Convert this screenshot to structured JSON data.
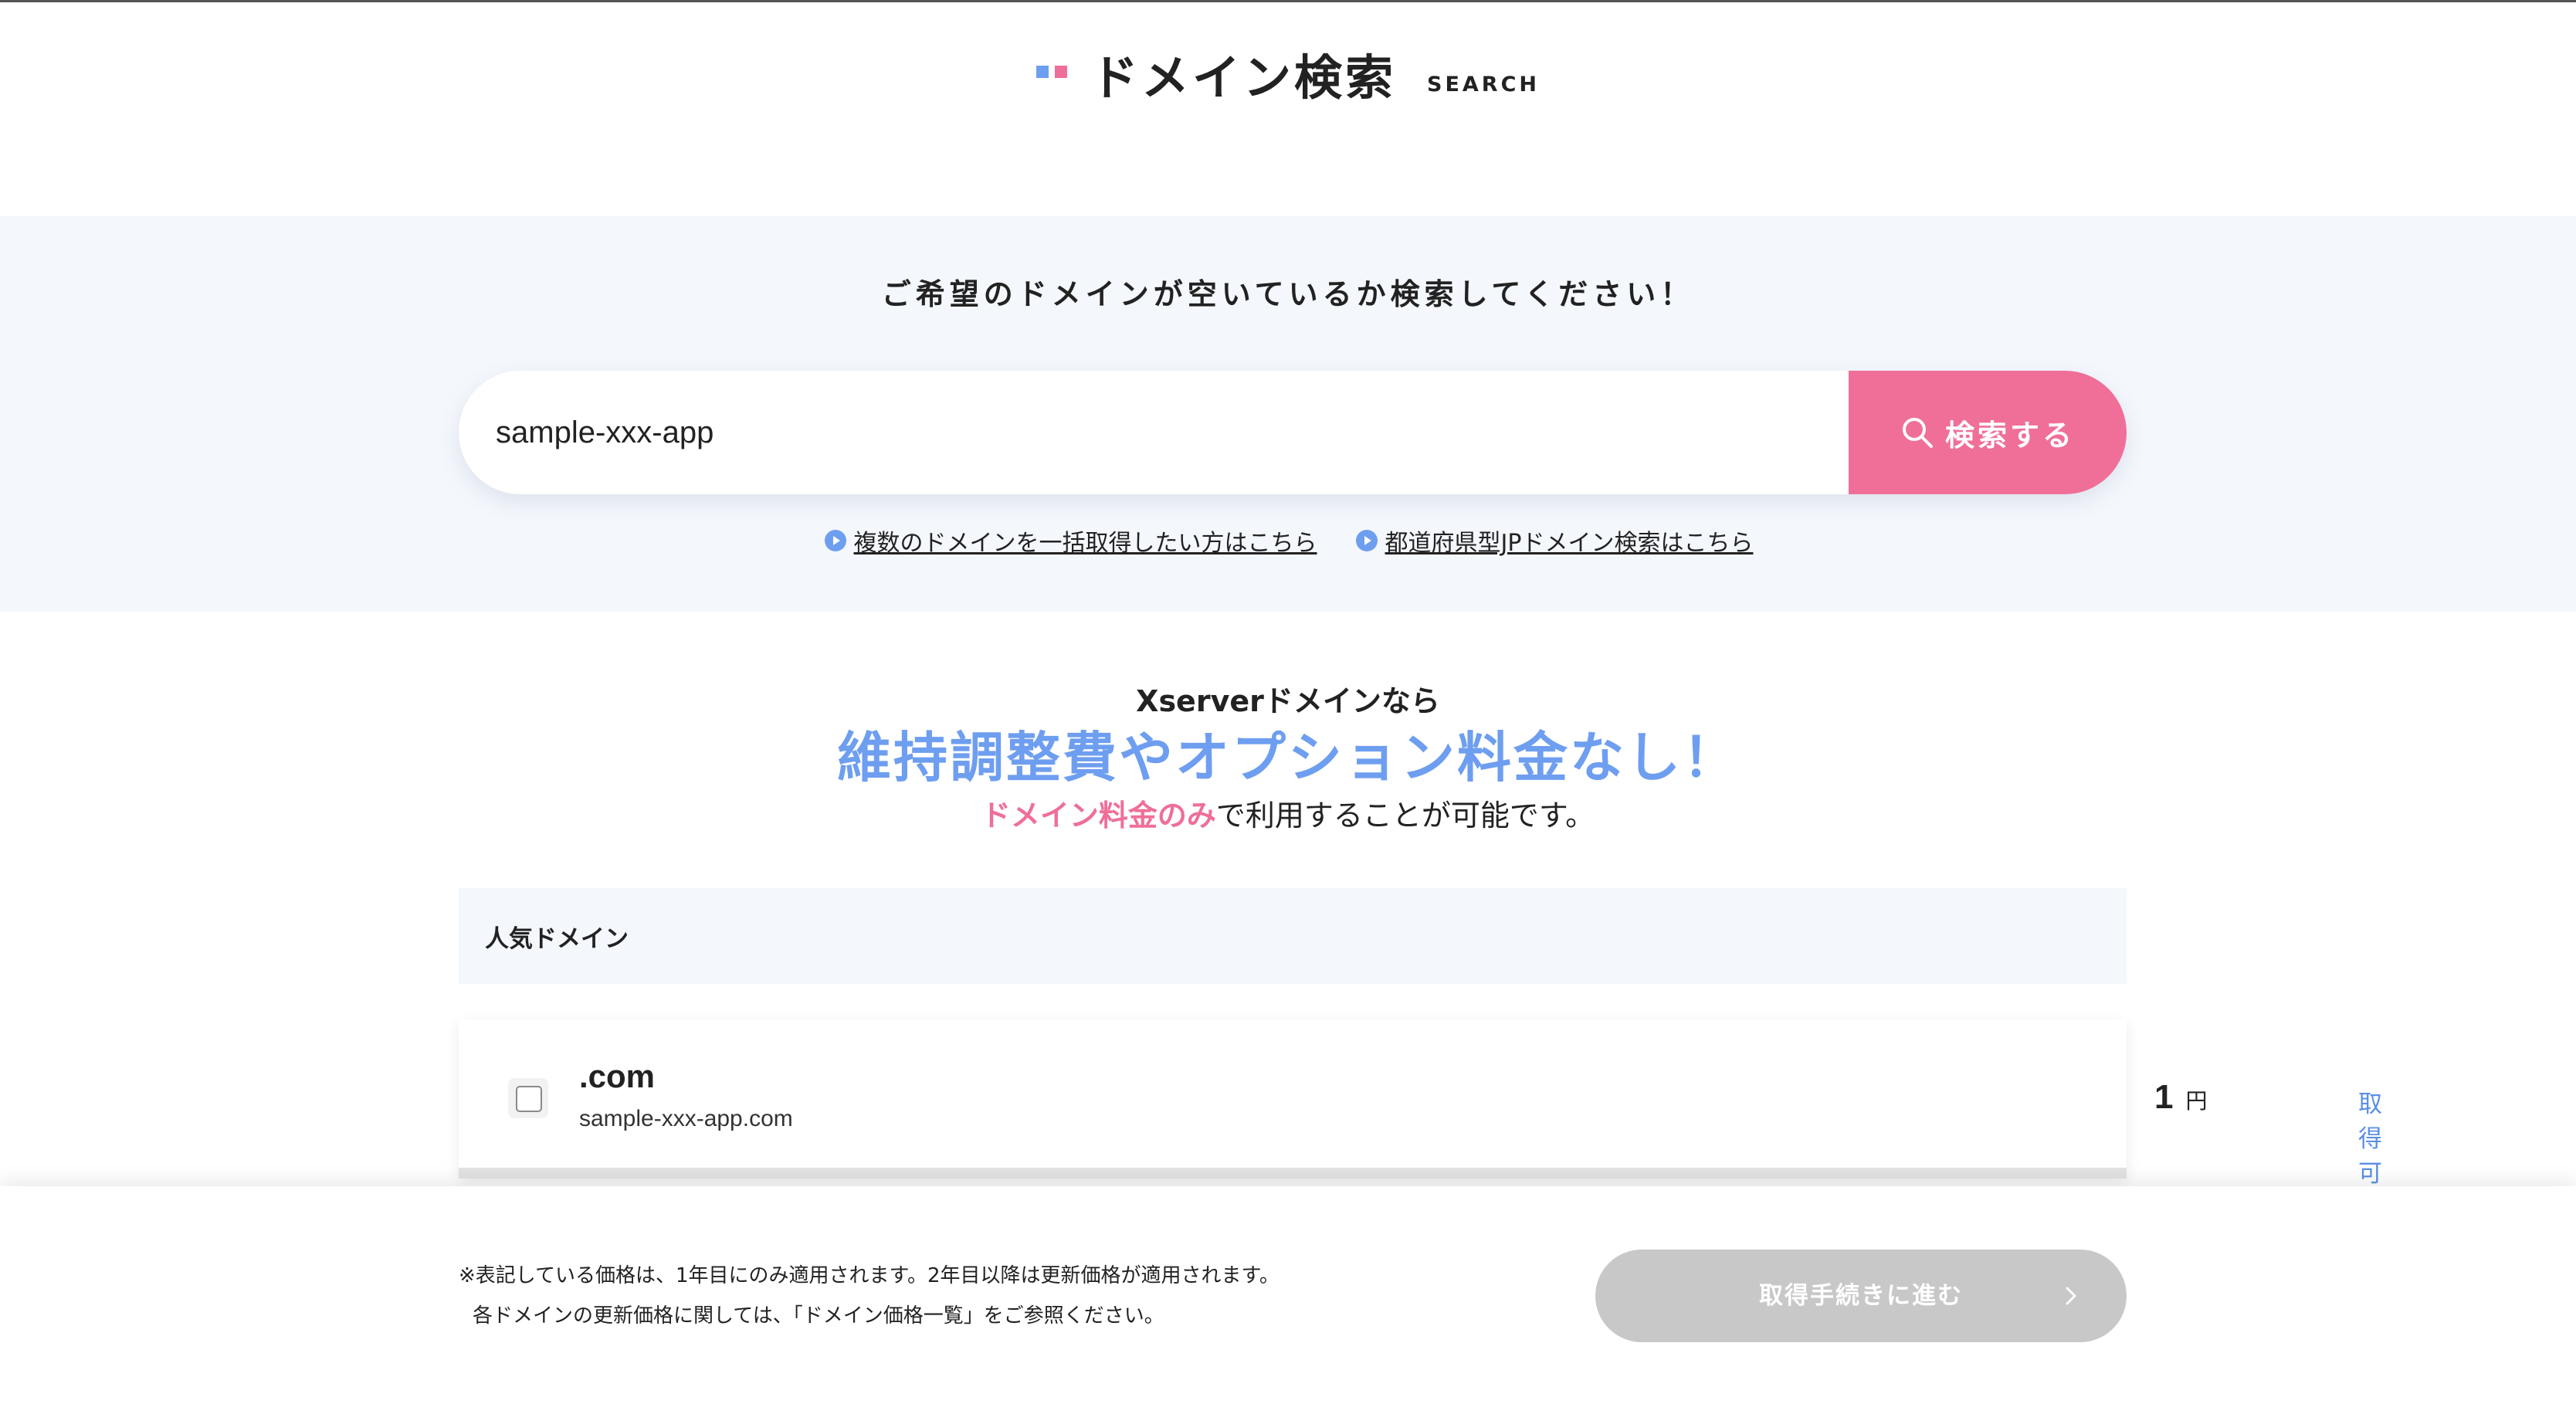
{
  "header": {
    "title": "ドメイン検索",
    "title_en": "SEARCH"
  },
  "search": {
    "prompt": "ご希望のドメインが空いているか検索してください！",
    "value": "sample-xxx-app",
    "button_label": "検索する",
    "links": [
      {
        "label": "複数のドメインを一括取得したい方はこちら",
        "icon": "circle-arrow-right-icon"
      },
      {
        "label": "都道府県型JPドメイン検索はこちら",
        "icon": "circle-arrow-right-icon"
      }
    ]
  },
  "promo": {
    "lead": "Xserverドメインなら",
    "headline": "維持調整費やオプション料金なし！",
    "sub_emphasis": "ドメイン料金のみ",
    "sub_rest": "で利用することが可能です。"
  },
  "popular": {
    "heading": "人気ドメイン",
    "rows": [
      {
        "tld": ".com",
        "domain": "sample-xxx-app.com",
        "price": "1",
        "unit": "円",
        "status": "取得可能です",
        "checked": false
      }
    ]
  },
  "footer": {
    "note_line1": "※表記している価格は、1年目にのみ適用されます。2年目以降は更新価格が適用されます。",
    "note_line2": "各ドメインの更新価格に関しては、「ドメイン価格一覧」をご参照ください。",
    "proceed_label": "取得手続きに進む",
    "proceed_icon": "chevron-right-icon"
  },
  "colors": {
    "accent_blue": "#6e9ef0",
    "accent_pink": "#ef6f98",
    "band_bg": "#f4f7fc",
    "button_disabled": "#c8c8c8",
    "status_blue": "#5b8fe6"
  }
}
